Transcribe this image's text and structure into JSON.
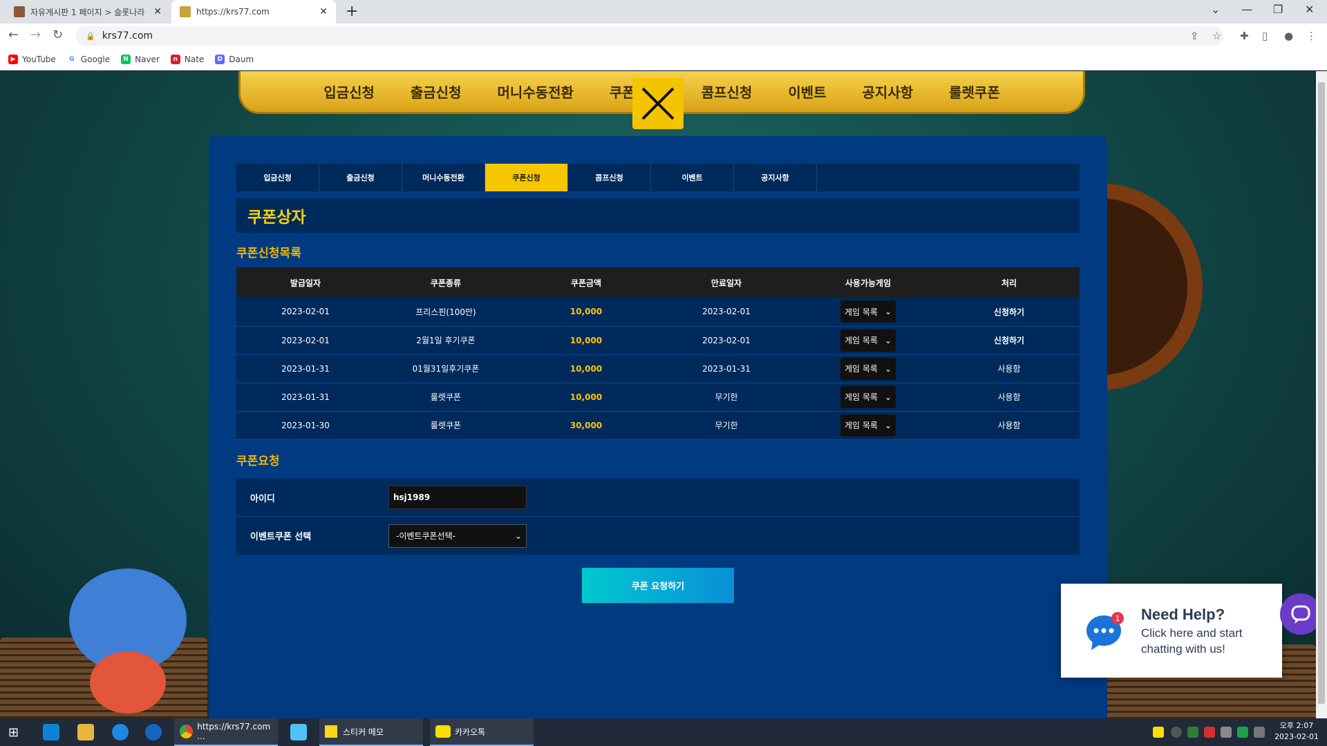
{
  "browser": {
    "tabs": [
      {
        "title": "자유게시판 1 페이지 > 슬롯나라",
        "active": false
      },
      {
        "title": "https://krs77.com",
        "active": true
      }
    ],
    "url": "krs77.com",
    "bookmarks": [
      "YouTube",
      "Google",
      "Naver",
      "Nate",
      "Daum"
    ]
  },
  "site": {
    "top_nav": [
      "입금신청",
      "출금신청",
      "머니수동전환",
      "쿠폰",
      "콤프신청",
      "이벤트",
      "공지사항",
      "룰렛쿠폰"
    ],
    "sub_tabs": [
      "입금신청",
      "출금신청",
      "머니수동전환",
      "쿠폰신청",
      "콤프신청",
      "이벤트",
      "공지사항"
    ],
    "active_sub_tab": "쿠폰신청",
    "page_title": "쿠폰상자",
    "list_title": "쿠폰신청목록",
    "table": {
      "headers": [
        "발급일자",
        "쿠폰종류",
        "쿠폰금액",
        "만료일자",
        "사용가능게임",
        "처리"
      ],
      "rows": [
        {
          "issued": "2023-02-01",
          "type": "프리스핀(100만)",
          "amount": "10,000",
          "expires": "2023-02-01",
          "game": "게임 목록",
          "action": "신청하기"
        },
        {
          "issued": "2023-02-01",
          "type": "2월1일 후기쿠폰",
          "amount": "10,000",
          "expires": "2023-02-01",
          "game": "게임 목록",
          "action": "신청하기"
        },
        {
          "issued": "2023-01-31",
          "type": "01월31일후기쿠폰",
          "amount": "10,000",
          "expires": "2023-01-31",
          "game": "게임 목록",
          "action": "사용함"
        },
        {
          "issued": "2023-01-31",
          "type": "룰렛쿠폰",
          "amount": "10,000",
          "expires": "무기한",
          "game": "게임 목록",
          "action": "사용함"
        },
        {
          "issued": "2023-01-30",
          "type": "룰렛쿠폰",
          "amount": "30,000",
          "expires": "무기한",
          "game": "게임 목록",
          "action": "사용함"
        }
      ]
    },
    "request_title": "쿠폰요청",
    "form": {
      "id_label": "아이디",
      "id_value": "hsj1989",
      "coupon_label": "이벤트쿠폰 선택",
      "coupon_value": "-이벤트쿠폰선택-"
    },
    "request_button": "쿠폰 요청하기"
  },
  "help_widget": {
    "title": "Need Help?",
    "line1": "Click here and start",
    "line2": "chatting with us!",
    "badge": "1"
  },
  "taskbar": {
    "apps": [
      "https://krs77.com ...",
      "스티커 메모",
      "카카오톡"
    ],
    "time": "오후 2:07",
    "date": "2023-02-01"
  },
  "colors": {
    "panel": "#003a80",
    "accent_yellow": "#f6c700",
    "amount": "#ffc400",
    "button_start": "#00c9cf",
    "button_end": "#0a8fd8"
  }
}
